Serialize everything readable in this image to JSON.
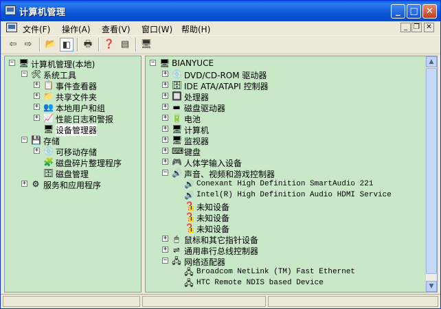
{
  "window": {
    "title": "计算机管理"
  },
  "menu": [
    {
      "label": "文件(F)"
    },
    {
      "label": "操作(A)"
    },
    {
      "label": "查看(V)"
    },
    {
      "label": "窗口(W)"
    },
    {
      "label": "帮助(H)"
    }
  ],
  "left_tree": [
    {
      "label": "计算机管理(本地)",
      "icon": "computer-management-icon",
      "glyph": "🖥",
      "exp": "-",
      "indent": 0
    },
    {
      "label": "系统工具",
      "icon": "system-tools-icon",
      "glyph": "🛠",
      "exp": "-",
      "indent": 1
    },
    {
      "label": "事件查看器",
      "icon": "event-viewer-icon",
      "glyph": "📋",
      "exp": "+",
      "indent": 2
    },
    {
      "label": "共享文件夹",
      "icon": "shared-folder-icon",
      "glyph": "📁",
      "exp": "+",
      "indent": 2
    },
    {
      "label": "本地用户和组",
      "icon": "users-icon",
      "glyph": "👥",
      "exp": "+",
      "indent": 2
    },
    {
      "label": "性能日志和警报",
      "icon": "performance-icon",
      "glyph": "📈",
      "exp": "+",
      "indent": 2
    },
    {
      "label": "设备管理器",
      "icon": "device-manager-icon",
      "glyph": "🖥",
      "exp": "",
      "indent": 2,
      "selected": true
    },
    {
      "label": "存储",
      "icon": "storage-icon",
      "glyph": "💾",
      "exp": "-",
      "indent": 1
    },
    {
      "label": "可移动存储",
      "icon": "removable-storage-icon",
      "glyph": "💿",
      "exp": "+",
      "indent": 2
    },
    {
      "label": "磁盘碎片整理程序",
      "icon": "defrag-icon",
      "glyph": "🧩",
      "exp": "",
      "indent": 2
    },
    {
      "label": "磁盘管理",
      "icon": "disk-management-icon",
      "glyph": "🗄",
      "exp": "",
      "indent": 2
    },
    {
      "label": "服务和应用程序",
      "icon": "services-icon",
      "glyph": "⚙",
      "exp": "+",
      "indent": 1
    }
  ],
  "right_tree": [
    {
      "label": "BIANYUCE",
      "icon": "computer-icon",
      "glyph": "🖥",
      "exp": "-",
      "indent": 0
    },
    {
      "label": "DVD/CD-ROM 驱动器",
      "icon": "dvd-drive-icon",
      "glyph": "💿",
      "exp": "+",
      "indent": 1
    },
    {
      "label": "IDE ATA/ATAPI 控制器",
      "icon": "ide-controller-icon",
      "glyph": "🗄",
      "exp": "+",
      "indent": 1
    },
    {
      "label": "处理器",
      "icon": "processor-icon",
      "glyph": "🔲",
      "exp": "+",
      "indent": 1
    },
    {
      "label": "磁盘驱动器",
      "icon": "disk-drive-icon",
      "glyph": "▬",
      "exp": "+",
      "indent": 1
    },
    {
      "label": "电池",
      "icon": "battery-icon",
      "glyph": "🔋",
      "exp": "+",
      "indent": 1
    },
    {
      "label": "计算机",
      "icon": "computer-icon",
      "glyph": "🖥",
      "exp": "+",
      "indent": 1
    },
    {
      "label": "监视器",
      "icon": "monitor-icon",
      "glyph": "🖥",
      "exp": "+",
      "indent": 1
    },
    {
      "label": "键盘",
      "icon": "keyboard-icon",
      "glyph": "⌨",
      "exp": "+",
      "indent": 1
    },
    {
      "label": "人体学输入设备",
      "icon": "hid-icon",
      "glyph": "🎮",
      "exp": "+",
      "indent": 1
    },
    {
      "label": "声音、视频和游戏控制器",
      "icon": "sound-icon",
      "glyph": "🔊",
      "exp": "-",
      "indent": 1
    },
    {
      "label": "Conexant High Definition SmartAudio 221",
      "icon": "audio-device-icon",
      "glyph": "🔊",
      "exp": "",
      "indent": 2,
      "mono": true
    },
    {
      "label": "Intel(R) High Definition Audio HDMI Service",
      "icon": "audio-device-icon",
      "glyph": "🔊",
      "exp": "",
      "indent": 2,
      "mono": true
    },
    {
      "label": "未知设备",
      "icon": "unknown-device-warning-icon",
      "glyph": "❓",
      "exp": "",
      "indent": 2,
      "warn": true
    },
    {
      "label": "未知设备",
      "icon": "unknown-device-warning-icon",
      "glyph": "❓",
      "exp": "",
      "indent": 2,
      "warn": true
    },
    {
      "label": "未知设备",
      "icon": "unknown-device-warning-icon",
      "glyph": "❓",
      "exp": "",
      "indent": 2,
      "warn": true
    },
    {
      "label": "鼠标和其它指针设备",
      "icon": "mouse-icon",
      "glyph": "🖱",
      "exp": "+",
      "indent": 1
    },
    {
      "label": "通用串行总线控制器",
      "icon": "usb-icon",
      "glyph": "⇌",
      "exp": "+",
      "indent": 1
    },
    {
      "label": "网络适配器",
      "icon": "network-adapter-icon",
      "glyph": "🖧",
      "exp": "-",
      "indent": 1
    },
    {
      "label": "Broadcom NetLink (TM) Fast Ethernet",
      "icon": "network-card-icon",
      "glyph": "🖧",
      "exp": "",
      "indent": 2,
      "mono": true
    },
    {
      "label": "HTC Remote NDIS based Device",
      "icon": "network-card-icon",
      "glyph": "🖧",
      "exp": "",
      "indent": 2,
      "mono": true
    }
  ]
}
